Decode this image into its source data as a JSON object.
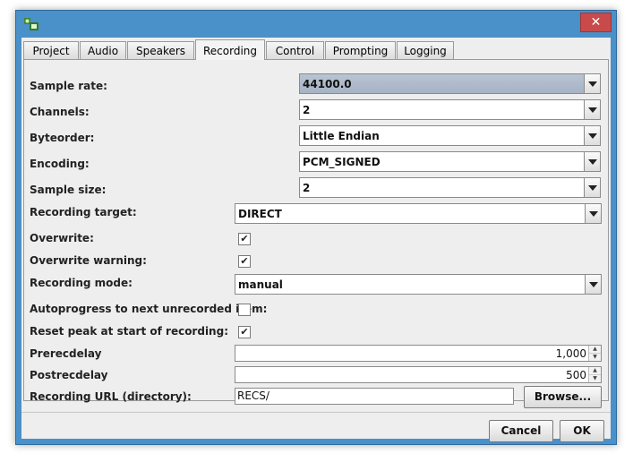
{
  "window": {
    "close_glyph": "✕"
  },
  "tabs": [
    {
      "label": "Project"
    },
    {
      "label": "Audio"
    },
    {
      "label": "Speakers"
    },
    {
      "label": "Recording",
      "active": true
    },
    {
      "label": "Control"
    },
    {
      "label": "Prompting"
    },
    {
      "label": "Logging"
    }
  ],
  "form": {
    "sample_rate": {
      "label": "Sample rate:",
      "value": "44100.0"
    },
    "channels": {
      "label": "Channels:",
      "value": "2"
    },
    "byteorder": {
      "label": "Byteorder:",
      "value": "Little Endian"
    },
    "encoding": {
      "label": "Encoding:",
      "value": "PCM_SIGNED"
    },
    "sample_size": {
      "label": "Sample size:",
      "value": "2"
    },
    "recording_target": {
      "label": "Recording target:",
      "value": "DIRECT"
    },
    "overwrite": {
      "label": "Overwrite:",
      "checked": true
    },
    "overwrite_warning": {
      "label": "Overwrite warning:",
      "checked": true
    },
    "recording_mode": {
      "label": "Recording mode:",
      "value": "manual"
    },
    "autoprogress": {
      "label": "Autoprogress to next unrecorded item:",
      "checked": false
    },
    "reset_peak": {
      "label": "Reset peak at start of recording:",
      "checked": true
    },
    "prerecdelay": {
      "label": "Prerecdelay",
      "value": "1,000"
    },
    "postrecdelay": {
      "label": "Postrecdelay",
      "value": "500"
    },
    "recording_url": {
      "label": "Recording URL (directory):",
      "value": "RECS/"
    }
  },
  "buttons": {
    "browse": "Browse...",
    "cancel": "Cancel",
    "ok": "OK"
  },
  "glyphs": {
    "check": "✔",
    "up": "▲",
    "down": "▼"
  },
  "colors": {
    "title_bar": "#4a90c9",
    "selected_combo": "#a6b3c4"
  }
}
